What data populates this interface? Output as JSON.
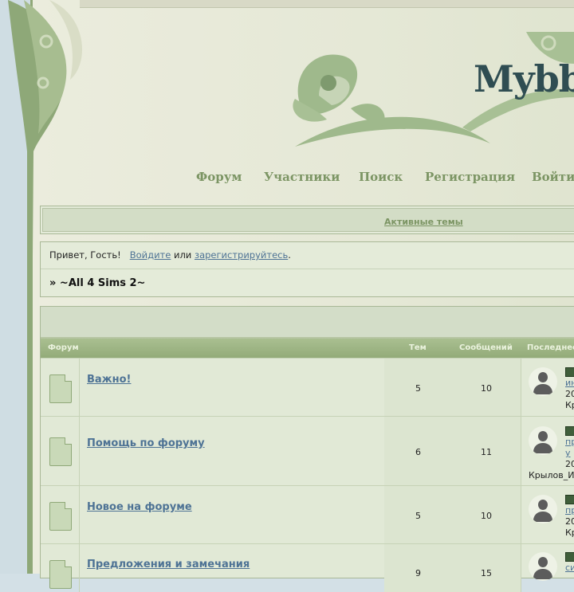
{
  "header": {
    "logo_text": "Mybb"
  },
  "nav": {
    "items": [
      "Форум",
      "Участники",
      "Поиск",
      "Регистрация",
      "Войти"
    ]
  },
  "active_topics": {
    "label": "Активные темы"
  },
  "welcome": {
    "greeting": "Привет, Гость!",
    "login": "Войдите",
    "or": "или",
    "register": "зарегистрируйтесь",
    "period": ".",
    "breadcrumb": "» ~All 4 Sims 2~"
  },
  "board": {
    "columns": {
      "forum": "Форум",
      "topics": "Тем",
      "posts": "Сообщений",
      "last": "Последнее"
    },
    "forums": [
      {
        "title": "Важно!",
        "topics": "5",
        "posts": "10",
        "last_lines": [
          "ин",
          "20",
          "Кр"
        ]
      },
      {
        "title": "Помощь по форуму",
        "topics": "6",
        "posts": "11",
        "last_lines": [
          "пр",
          "у",
          "20",
          "Крылов_И"
        ]
      },
      {
        "title": "Новое на форуме",
        "topics": "5",
        "posts": "10",
        "last_lines": [
          "пр",
          "20",
          "Кр"
        ]
      },
      {
        "title": "Предложения и замечания",
        "topics": "9",
        "posts": "15",
        "last_lines": [
          "си"
        ]
      }
    ]
  },
  "colors": {
    "accent": "#7c9564",
    "link": "#4e7395",
    "panel": "#e4ebd9",
    "header_row": "#9fb685"
  }
}
